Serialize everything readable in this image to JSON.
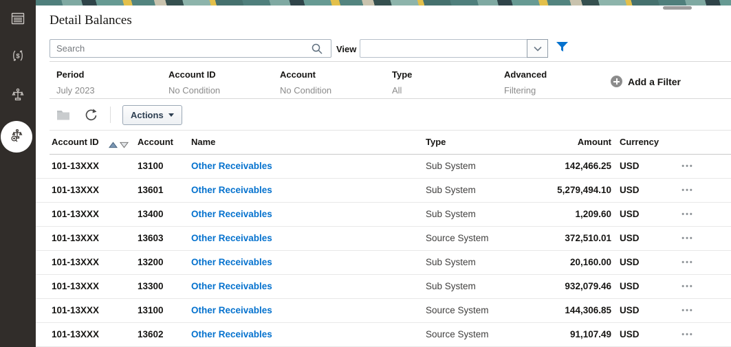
{
  "page": {
    "title": "Detail Balances"
  },
  "sidebar": {
    "bg_color": "#312d2a",
    "items": [
      {
        "icon": "table-list-icon",
        "selected": false
      },
      {
        "icon": "currency-exchange-icon",
        "selected": false
      },
      {
        "icon": "balance-scale-icon",
        "selected": false
      },
      {
        "icon": "balance-inspect-icon",
        "selected": true
      }
    ]
  },
  "search": {
    "placeholder": "Search",
    "icon": "search-icon"
  },
  "view": {
    "label": "View",
    "value": "",
    "icons": [
      "chevron-down-icon",
      "filter-funnel-icon"
    ]
  },
  "filters": {
    "items": [
      {
        "label": "Period",
        "value": "July 2023"
      },
      {
        "label": "Account ID",
        "value": "No Condition"
      },
      {
        "label": "Account",
        "value": "No Condition"
      },
      {
        "label": "Type",
        "value": "All"
      },
      {
        "label": "Advanced",
        "value": "Filtering"
      }
    ],
    "add_label": "Add a Filter",
    "add_icon": "plus-circle-icon"
  },
  "toolbar": {
    "icons": [
      "folder-icon",
      "refresh-icon"
    ],
    "actions_label": "Actions"
  },
  "table": {
    "headers": {
      "accountId": "Account ID",
      "account": "Account",
      "name": "Name",
      "type": "Type",
      "amount": "Amount",
      "currency": "Currency"
    },
    "sort": {
      "column": "Account ID",
      "icons": [
        "sort-ascending-icon",
        "sort-descending-icon"
      ]
    },
    "row_menu_icon": "•••",
    "rows": [
      {
        "accountId": "101-13XXX",
        "account": "13100",
        "name": "Other Receivables",
        "type": "Sub System",
        "amount": "142,466.25",
        "currency": "USD"
      },
      {
        "accountId": "101-13XXX",
        "account": "13601",
        "name": "Other Receivables",
        "type": "Sub System",
        "amount": "5,279,494.10",
        "currency": "USD"
      },
      {
        "accountId": "101-13XXX",
        "account": "13400",
        "name": "Other Receivables",
        "type": "Sub System",
        "amount": "1,209.60",
        "currency": "USD"
      },
      {
        "accountId": "101-13XXX",
        "account": "13603",
        "name": "Other Receivables",
        "type": "Source System",
        "amount": "372,510.01",
        "currency": "USD"
      },
      {
        "accountId": "101-13XXX",
        "account": "13200",
        "name": "Other Receivables",
        "type": "Sub System",
        "amount": "20,160.00",
        "currency": "USD"
      },
      {
        "accountId": "101-13XXX",
        "account": "13300",
        "name": "Other Receivables",
        "type": "Sub System",
        "amount": "932,079.46",
        "currency": "USD"
      },
      {
        "accountId": "101-13XXX",
        "account": "13100",
        "name": "Other Receivables",
        "type": "Source System",
        "amount": "144,306.85",
        "currency": "USD"
      },
      {
        "accountId": "101-13XXX",
        "account": "13602",
        "name": "Other Receivables",
        "type": "Source System",
        "amount": "91,107.49",
        "currency": "USD"
      }
    ]
  },
  "colors": {
    "link_blue": "#0572ce",
    "accent_blue": "#0572ce",
    "sidebar_bg": "#312d2a",
    "text_dark": "#161513",
    "muted_grey": "#8b8b8b"
  }
}
